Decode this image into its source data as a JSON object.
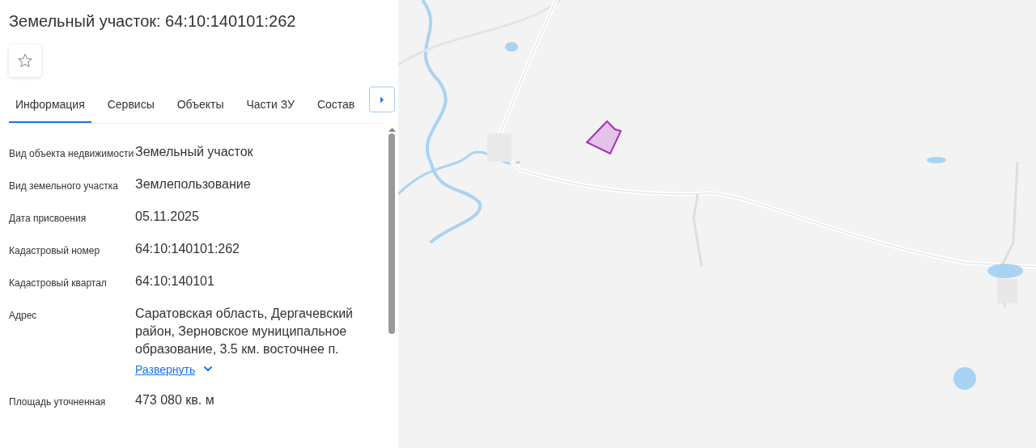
{
  "title": "Земельный участок: 64:10:140101:262",
  "favorite": {
    "selected": false
  },
  "tabs": [
    {
      "label": "Информация",
      "selected": true
    },
    {
      "label": "Сервисы",
      "selected": false
    },
    {
      "label": "Объекты",
      "selected": false
    },
    {
      "label": "Части ЗУ",
      "selected": false
    },
    {
      "label": "Состав",
      "selected": false
    }
  ],
  "fields": [
    {
      "label": "Вид объекта недвижимости",
      "value": "Земельный участок"
    },
    {
      "label": "Вид земельного участка",
      "value": "Землепользование"
    },
    {
      "label": "Дата присвоения",
      "value": "05.11.2025"
    },
    {
      "label": "Кадастровый номер",
      "value": "64:10:140101:262"
    },
    {
      "label": "Кадастровый квартал",
      "value": "64:10:140101"
    },
    {
      "label": "Адрес",
      "value": "Саратовская область, Дергачевский район, Зерновское муниципальное образование, 3.5 км. восточнее п.",
      "expand_link": "Развернуть"
    },
    {
      "label": "Площадь уточненная",
      "value": "473 080 кв. м"
    }
  ]
}
